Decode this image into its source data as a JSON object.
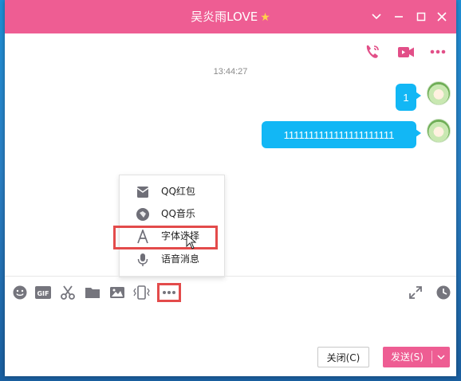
{
  "window": {
    "title": "吴炎雨LOVE",
    "title_badge_icon": "star-icon",
    "controls": [
      "chevron-down-icon",
      "minimize-icon",
      "maximize-icon",
      "close-icon"
    ],
    "accent_color": "#ee5d93"
  },
  "header_actions": [
    "phone-call-icon",
    "video-call-icon",
    "more-icon"
  ],
  "chat": {
    "timestamp": "13:44:27",
    "messages": [
      {
        "text": "1",
        "sender": "me"
      },
      {
        "text": "1111111111111111111111",
        "sender": "me"
      }
    ],
    "bubble_color": "#12b7f5"
  },
  "popup_menu": {
    "items": [
      {
        "label": "QQ红包",
        "icon": "red-envelope-icon"
      },
      {
        "label": "QQ音乐",
        "icon": "music-icon"
      },
      {
        "label": "字体选择",
        "icon": "font-icon",
        "highlighted": true
      },
      {
        "label": "语音消息",
        "icon": "microphone-icon"
      }
    ]
  },
  "toolbar": {
    "left_icons": [
      "emoji-icon",
      "gif-icon",
      "scissors-icon",
      "folder-icon",
      "image-icon",
      "shake-icon",
      "more-options-icon"
    ],
    "right_icons": [
      "expand-icon",
      "history-clock-icon"
    ],
    "more_highlighted": true,
    "highlight_color": "#e34b4b"
  },
  "footer": {
    "close_label": "关闭(C)",
    "send_label": "发送(S)"
  }
}
